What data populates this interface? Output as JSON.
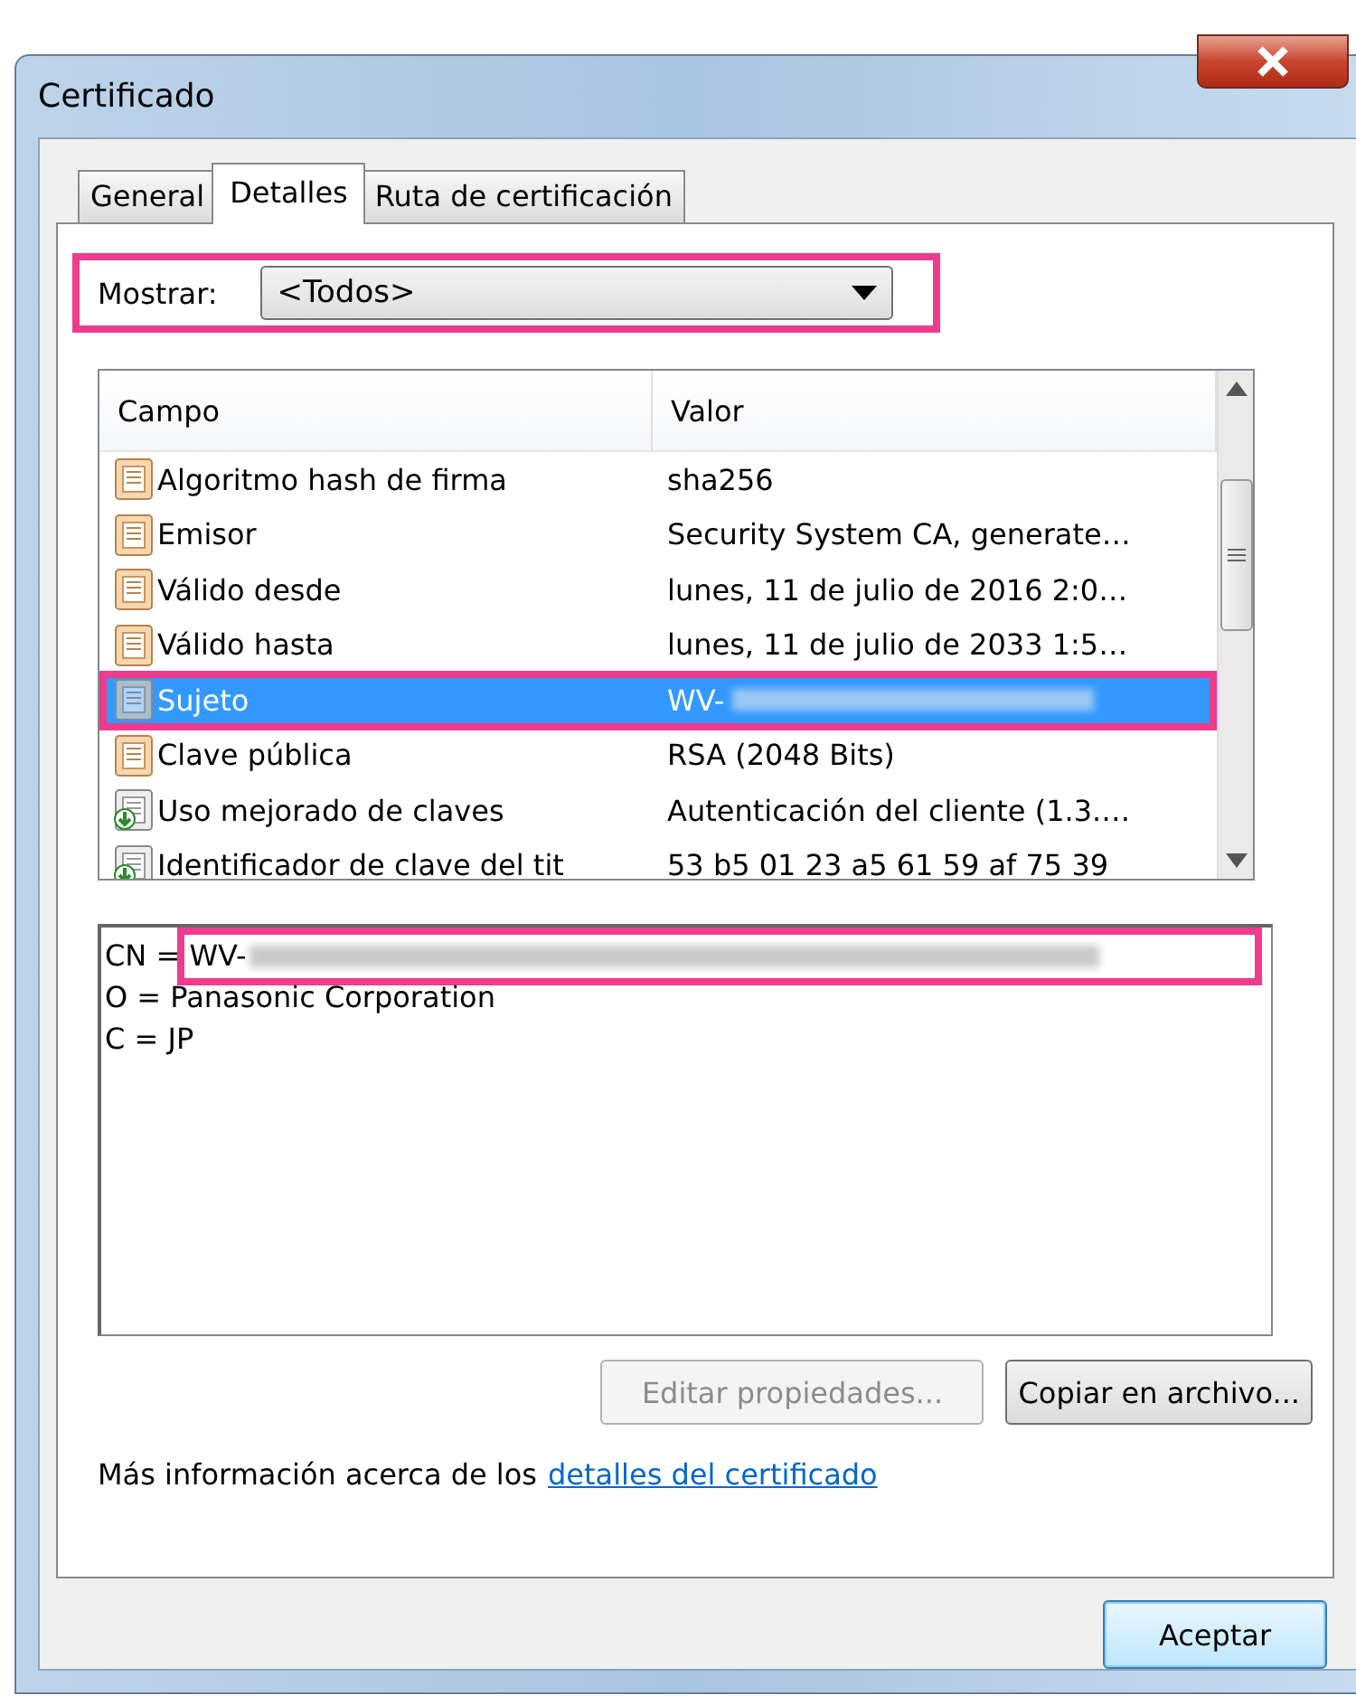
{
  "window": {
    "title": "Certificado"
  },
  "tabs": [
    {
      "label": "General",
      "selected": false
    },
    {
      "label": "Detalles",
      "selected": true
    },
    {
      "label": "Ruta de certificación",
      "selected": false
    }
  ],
  "show": {
    "label": "Mostrar:",
    "value": "<Todos>"
  },
  "table": {
    "columns": [
      "Campo",
      "Valor"
    ],
    "rows": [
      {
        "kind": "field",
        "field": "Algoritmo hash de firma",
        "value": "sha256",
        "selected": false
      },
      {
        "kind": "field",
        "field": "Emisor",
        "value": "Security System CA, generate…",
        "selected": false
      },
      {
        "kind": "field",
        "field": "Válido desde",
        "value": "lunes, 11 de julio de 2016 2:0…",
        "selected": false
      },
      {
        "kind": "field",
        "field": "Válido hasta",
        "value": "lunes, 11 de julio de 2033 1:5…",
        "selected": false
      },
      {
        "kind": "field",
        "field": "Sujeto",
        "value": "WV-",
        "redacted": true,
        "selected": true
      },
      {
        "kind": "field",
        "field": "Clave pública",
        "value": "RSA (2048 Bits)",
        "selected": false
      },
      {
        "kind": "extension",
        "field": "Uso mejorado de claves",
        "value": "Autenticación del cliente (1.3.…",
        "selected": false
      },
      {
        "kind": "extension",
        "field": "Identificador de clave del tit",
        "value": "53 b5 01 23 a5 61 59 af 75 39",
        "selected": false
      }
    ]
  },
  "detail_lines": [
    {
      "text": "CN = WV-",
      "redacted": true
    },
    {
      "text": "O = Panasonic Corporation",
      "redacted": false
    },
    {
      "text": "C = JP",
      "redacted": false
    }
  ],
  "buttons": [
    {
      "label": "Editar propiedades...",
      "disabled": true
    },
    {
      "label": "Copiar en archivo...",
      "disabled": false
    }
  ],
  "info": {
    "text": "Más información acerca de los",
    "link": "detalles del certificado"
  },
  "ok_button": "Aceptar"
}
